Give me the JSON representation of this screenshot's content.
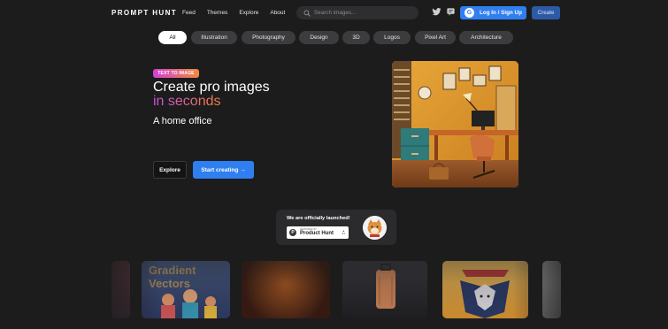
{
  "header": {
    "logo": "PROMPT HUNT",
    "nav": [
      "Feed",
      "Themes",
      "Explore",
      "About"
    ],
    "search_placeholder": "Search images...",
    "login_label": "Log In / Sign Up",
    "create_label": "Create"
  },
  "filters": {
    "active": "All",
    "items": [
      "All",
      "Illustration",
      "Photography",
      "Design",
      "3D",
      "Logos",
      "Pixel Art",
      "Architecture"
    ]
  },
  "hero": {
    "badge": "TEXT TO IMAGE",
    "title_line1": "Create pro images",
    "title_line2": "in seconds",
    "prompt": "A home office",
    "explore_label": "Explore",
    "start_label": "Start creating →"
  },
  "launch": {
    "title": "We are officially launched!",
    "ph_small": "FEATURED ON",
    "ph_name": "Product Hunt",
    "ph_upvotes": "▲",
    "ph_count": "81"
  },
  "gallery": {
    "tile2_text_line1": "Gradient",
    "tile2_text_line2": "Vectors"
  },
  "colors": {
    "background": "#1c1c1d",
    "accent_blue": "#2f7ff0",
    "gradient_start": "#c94fe0",
    "gradient_end": "#f0803a"
  }
}
